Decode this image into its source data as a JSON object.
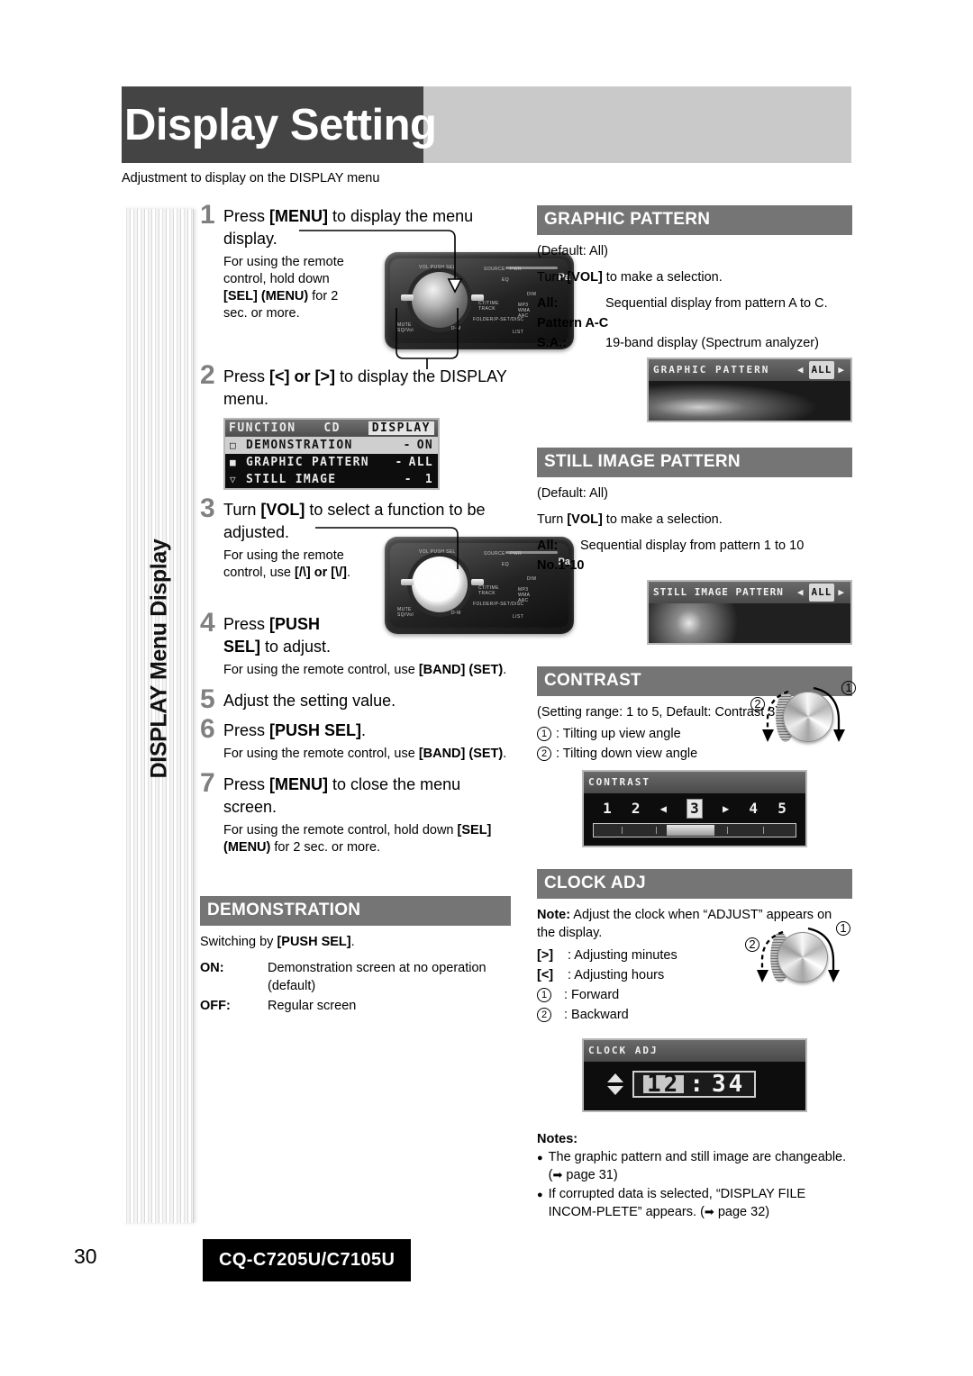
{
  "header": {
    "title": "Display Setting",
    "subtitle": "Adjustment to display on the DISPLAY menu"
  },
  "side_tab": {
    "label": "DISPLAY Menu Display"
  },
  "steps": [
    {
      "num": "1",
      "title_a": "Press ",
      "title_b": "[MENU]",
      "title_c": " to display the menu display.",
      "note": "For using the remote control, hold down [SEL] (MENU) for 2 sec. or more.",
      "note_parts": [
        "For using the remote control, hold down ",
        "[SEL] (MENU)",
        " for 2 sec. or more."
      ]
    },
    {
      "num": "2",
      "title_a": "Press ",
      "title_b": "[<] or [>]",
      "title_c": " to display the DISPLAY menu."
    },
    {
      "num": "3",
      "title_a": "Turn ",
      "title_b": "[VOL]",
      "title_c": " to select a function to be adjusted.",
      "note_parts": [
        "For using the remote control, use ",
        "[/\\] or [\\/]",
        "."
      ]
    },
    {
      "num": "4",
      "title_a": "Press ",
      "title_b": "[PUSH SEL]",
      "title_c": " to adjust.",
      "note_parts": [
        "For using the remote control, use ",
        "[BAND] (SET)",
        "."
      ]
    },
    {
      "num": "5",
      "title_a": "Adjust the setting value.",
      "title_b": "",
      "title_c": ""
    },
    {
      "num": "6",
      "title_a": "Press ",
      "title_b": "[PUSH SEL]",
      "title_c": ".",
      "note_parts": [
        "For using the remote control, use ",
        "[BAND] (SET)",
        "."
      ]
    },
    {
      "num": "7",
      "title_a": "Press ",
      "title_b": "[MENU]",
      "title_c": " to close the menu screen.",
      "note_parts": [
        "For using the remote control, hold down ",
        "[SEL] (MENU)",
        " for 2 sec. or more."
      ]
    }
  ],
  "menu_lcd": {
    "tabs": [
      "FUNCTION",
      "CD",
      "DISPLAY"
    ],
    "selected_tab": "DISPLAY",
    "rows": [
      {
        "mark": "□",
        "name": "DEMONSTRATION",
        "sep": "-",
        "value": "ON",
        "highlight": true
      },
      {
        "mark": "■",
        "name": "GRAPHIC PATTERN",
        "sep": "-",
        "value": "ALL",
        "highlight": false
      },
      {
        "mark": "▽",
        "name": "STILL IMAGE",
        "sep": "-",
        "value": "1",
        "highlight": false
      }
    ]
  },
  "sections": {
    "demonstration": {
      "heading": "DEMONSTRATION",
      "intro_a": "Switching by ",
      "intro_b": "[PUSH SEL]",
      "intro_c": ".",
      "items": [
        {
          "key": "ON:",
          "value": "Demonstration screen at no operation (default)"
        },
        {
          "key": "OFF:",
          "value": "Regular screen"
        }
      ]
    },
    "graphic_pattern": {
      "heading": "GRAPHIC PATTERN",
      "default_text": "(Default: All)",
      "turn_a": "Turn ",
      "turn_b": "[VOL]",
      "turn_c": " to make a selection.",
      "items": [
        {
          "key": "All:",
          "value": "Sequential display from pattern A to C."
        },
        {
          "key": "Pattern A-C",
          "value": ""
        },
        {
          "key": "S.A.:",
          "value": "19-band display (Spectrum analyzer)"
        }
      ],
      "lcd_title": "GRAPHIC PATTERN",
      "lcd_value": "ALL"
    },
    "still_image_pattern": {
      "heading": "STILL IMAGE PATTERN",
      "default_text": "(Default: All)",
      "turn_a": "Turn ",
      "turn_b": "[VOL]",
      "turn_c": " to make a selection.",
      "items": [
        {
          "key": "All:",
          "value": "Sequential display from pattern 1 to 10"
        },
        {
          "key": "No.1-10",
          "value": ""
        }
      ],
      "lcd_title": "STILL IMAGE PATTERN",
      "lcd_value": "ALL"
    },
    "contrast": {
      "heading": "CONTRAST",
      "range_text": "(Setting range: 1 to 5, Default: Contrast 3)",
      "items": [
        {
          "key": "1",
          "value": ": Tilting up view angle"
        },
        {
          "key": "2",
          "value": ": Tilting down view angle"
        }
      ],
      "lcd_title": "CONTRAST",
      "lcd_values": [
        "1",
        "2",
        "3",
        "4",
        "5"
      ],
      "lcd_selected": "3",
      "knob_labels": [
        "1",
        "2"
      ]
    },
    "clock_adj": {
      "heading": "CLOCK ADJ",
      "note_label": "Note:",
      "note_text": " Adjust the clock when “ADJUST” appears on the display.",
      "items": [
        {
          "key": "[>]",
          "value": ": Adjusting minutes"
        },
        {
          "key": "[<]",
          "value": ": Adjusting hours"
        },
        {
          "key": "1",
          "value": ": Forward",
          "circled": true
        },
        {
          "key": "2",
          "value": ": Backward",
          "circled": true
        }
      ],
      "lcd_title": "CLOCK ADJ",
      "lcd_hours": "12",
      "lcd_colon": ":",
      "lcd_minutes": "34",
      "knob_labels": [
        "1",
        "2"
      ]
    },
    "notes": {
      "heading": "Notes:",
      "items": [
        {
          "text_a": "The graphic pattern and still image are changeable. (",
          "arrow": "➡",
          "text_b": " page 31)"
        },
        {
          "text_a": "If corrupted data is selected, “DISPLAY FILE INCOM-PLETE” appears. (",
          "arrow": "➡",
          "text_b": " page 32)"
        }
      ]
    }
  },
  "footer": {
    "page_number": "30",
    "model": "CQ-C7205U/C7105U"
  }
}
